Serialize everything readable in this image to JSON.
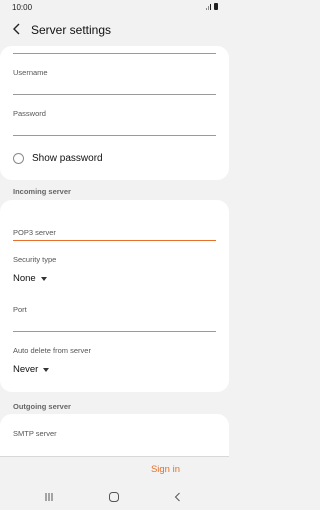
{
  "status_bar": {
    "time": "10:00"
  },
  "app_bar": {
    "title": "Server settings",
    "back_icon": "chevron-left-icon"
  },
  "account": {
    "username_label": "Username",
    "username_value": "",
    "password_label": "Password",
    "password_value": "",
    "show_password_label": "Show password",
    "show_password_checked": false
  },
  "incoming": {
    "header": "Incoming server",
    "pop3_label": "POP3 server",
    "pop3_value": "",
    "security_label": "Security type",
    "security_value": "None",
    "port_label": "Port",
    "port_value": "",
    "auto_delete_label": "Auto delete from server",
    "auto_delete_value": "Never"
  },
  "outgoing": {
    "header": "Outgoing server",
    "smtp_label": "SMTP server"
  },
  "actions": {
    "sign_in_label": "Sign in"
  },
  "colors": {
    "accent": "#e4702c",
    "background": "#f2f2f2",
    "card": "#ffffff"
  },
  "nav_bar": {
    "icons": [
      "recent-apps-icon",
      "home-icon",
      "back-icon"
    ]
  }
}
